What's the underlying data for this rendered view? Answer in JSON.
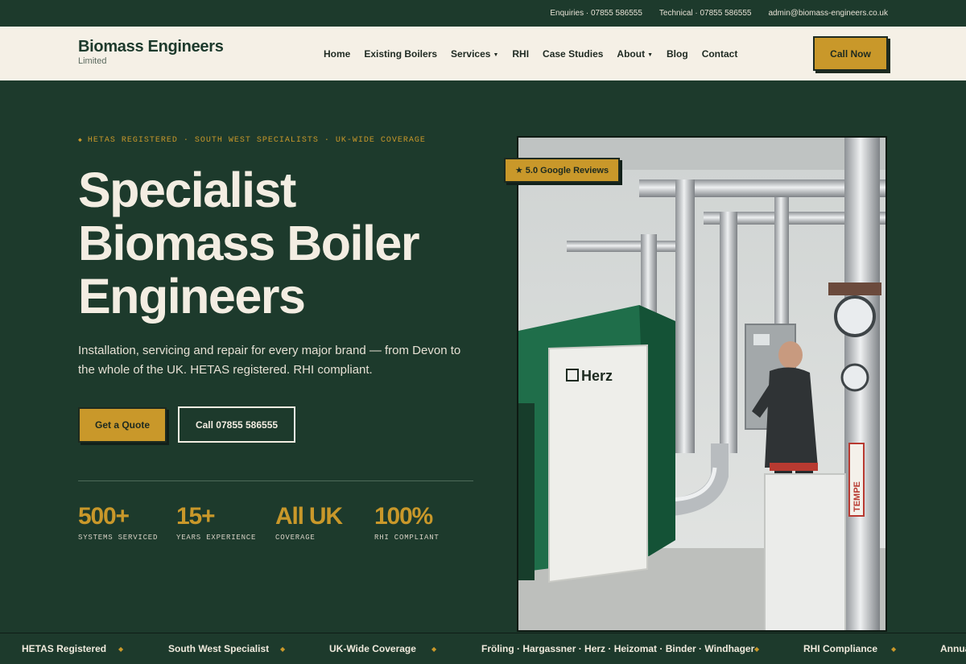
{
  "topbar": {
    "enquiries": "Enquiries · 07855 586555",
    "technical": "Technical · 07855 586555",
    "email": "admin@biomass-engineers.co.uk"
  },
  "header": {
    "logo_name": "Biomass Engineers",
    "logo_sub": "Limited",
    "nav": [
      "Home",
      "Existing Boilers",
      "Services",
      "RHI",
      "Case Studies",
      "About",
      "Blog",
      "Contact"
    ],
    "call_now": "Call Now"
  },
  "hero": {
    "eyebrow": "HETAS REGISTERED · SOUTH WEST SPECIALISTS · UK-WIDE COVERAGE",
    "headline": [
      "Specialist",
      "Biomass Boiler",
      "Engineers"
    ],
    "subtext": [
      "Installation, servicing and repair for every major brand — from Devon to",
      "the whole of the UK. HETAS registered. RHI compliant."
    ],
    "btn_quote": "Get a Quote",
    "btn_call": "Call 07855 586555",
    "stats": [
      {
        "value": "500+",
        "label": "SYSTEMS SERVICED"
      },
      {
        "value": "15+",
        "label": "YEARS EXPERIENCE"
      },
      {
        "value": "All UK",
        "label": "COVERAGE"
      },
      {
        "value": "100%",
        "label": "RHI COMPLIANT"
      }
    ],
    "badge": "★ 5.0 Google Reviews",
    "photo": {
      "brand_label": "Herz",
      "sign_label": "TEMPE"
    }
  },
  "ticker": [
    "HETAS Registered",
    "South West Specialist",
    "UK-Wide Coverage",
    "Fröling · Hargassner · Herz · Heizomat · Binder · Windhager",
    "RHI Compliance",
    "Annual"
  ],
  "colors": {
    "primary": "#1d3a2c",
    "accent": "#c9982a",
    "cream": "#f5f0e6"
  }
}
